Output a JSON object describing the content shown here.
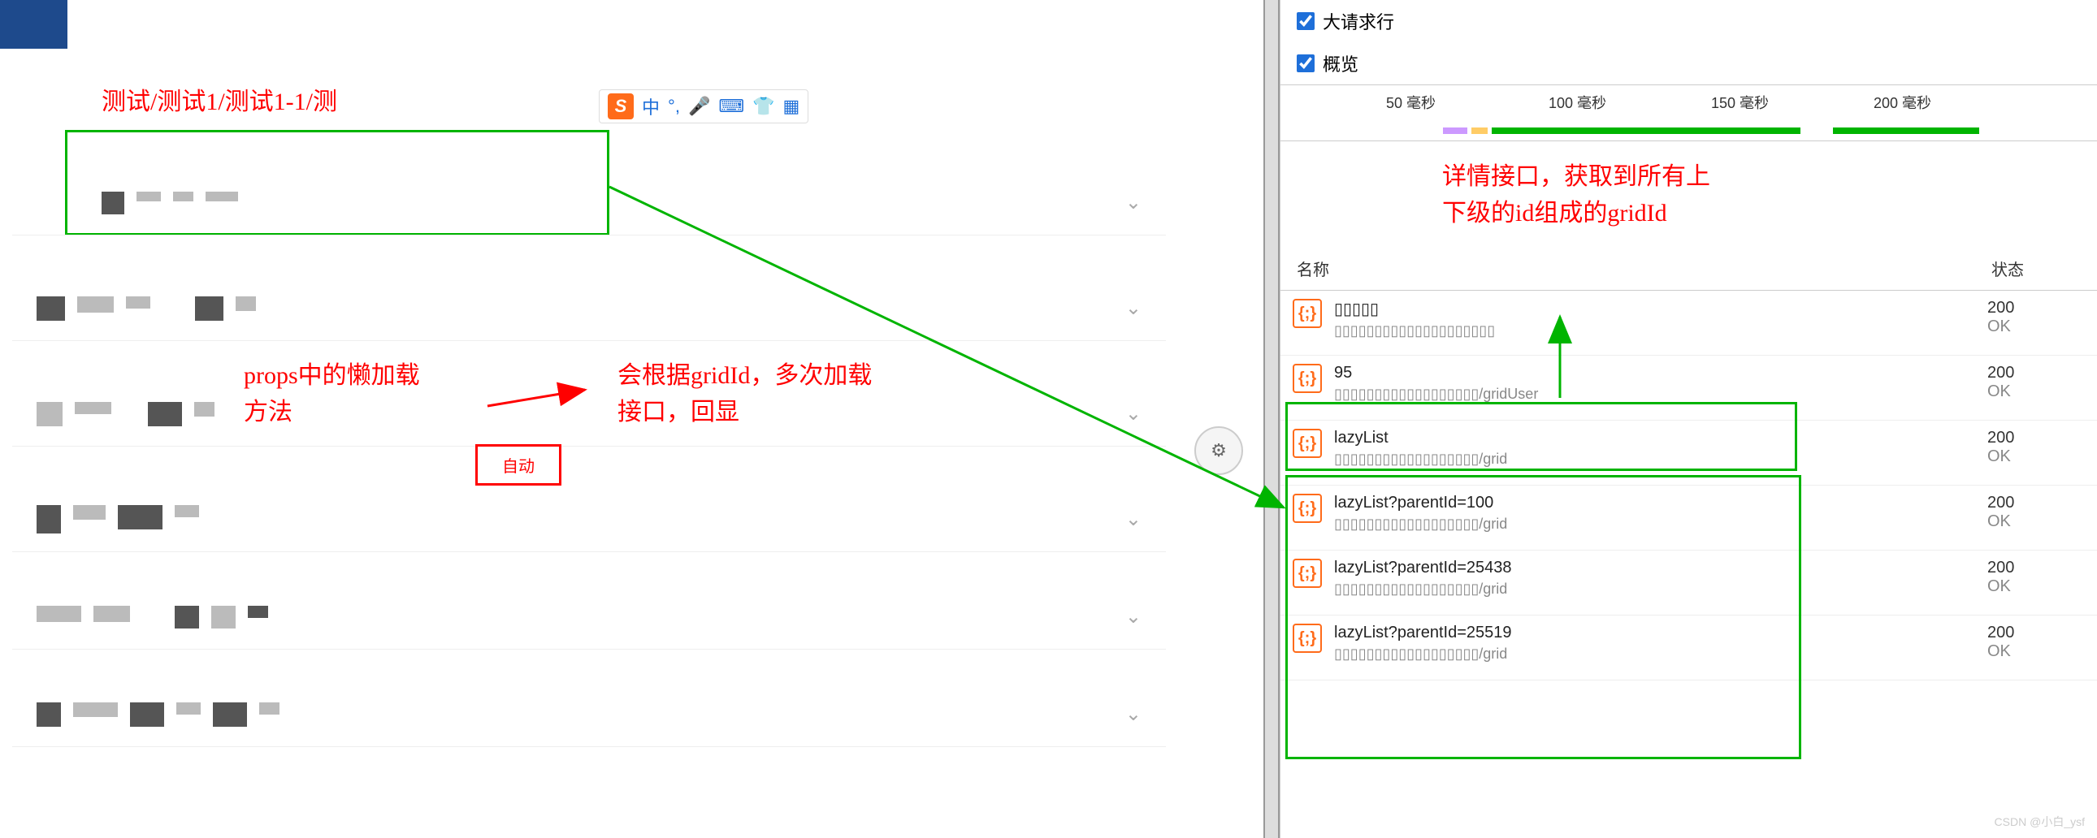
{
  "breadcrumb": "测试/测试1/测试1-1/测",
  "ime": {
    "logo": "S",
    "lang": "中"
  },
  "close": "×",
  "annotations": {
    "left1": "props中的懒加载\n方法",
    "left2_line1": "会根据gridId，多次加载",
    "left2_line2": "接口，回显",
    "auto_box": "自动",
    "right_note_line1": "详情接口，获取到所有上",
    "right_note_line2": "下级的id组成的gridId"
  },
  "devtools": {
    "checkbox1": "大请求行",
    "checkbox2": "概览",
    "timeline_ticks": [
      "50 毫秒",
      "100 毫秒",
      "150 毫秒",
      "200 毫秒"
    ],
    "header_name": "名称",
    "header_status": "状态",
    "rows": [
      {
        "name": "▯▯▯▯▯",
        "url": "▯▯▯▯▯▯▯▯▯▯▯▯▯▯▯▯▯▯▯▯",
        "code": "200",
        "ok": "OK"
      },
      {
        "name": "95",
        "url": "▯▯▯▯▯▯▯▯▯▯▯▯▯▯▯▯▯▯/gridUser",
        "code": "200",
        "ok": "OK"
      },
      {
        "name": "lazyList",
        "url": "▯▯▯▯▯▯▯▯▯▯▯▯▯▯▯▯▯▯/grid",
        "code": "200",
        "ok": "OK"
      },
      {
        "name": "lazyList?parentId=100",
        "url": "▯▯▯▯▯▯▯▯▯▯▯▯▯▯▯▯▯▯/grid",
        "code": "200",
        "ok": "OK"
      },
      {
        "name": "lazyList?parentId=25438",
        "url": "▯▯▯▯▯▯▯▯▯▯▯▯▯▯▯▯▯▯/grid",
        "code": "200",
        "ok": "OK"
      },
      {
        "name": "lazyList?parentId=25519",
        "url": "▯▯▯▯▯▯▯▯▯▯▯▯▯▯▯▯▯▯/grid",
        "code": "200",
        "ok": "OK"
      }
    ]
  },
  "watermark": "CSDN @小白_ysf"
}
